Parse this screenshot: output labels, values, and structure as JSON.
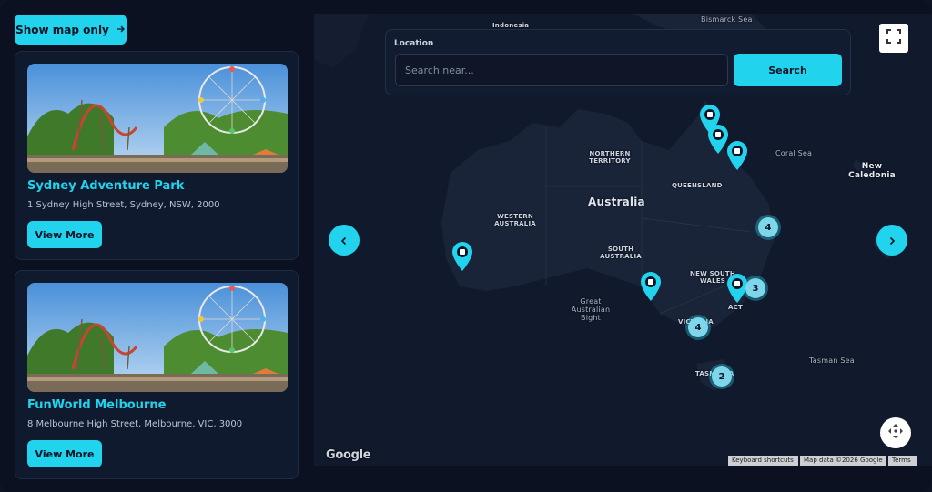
{
  "toolbar": {
    "show_map_label": "Show map only"
  },
  "listings": [
    {
      "title": "Sydney Adventure Park",
      "address": "1 Sydney High Street, Sydney, NSW, 2000",
      "cta": "View More"
    },
    {
      "title": "FunWorld Melbourne",
      "address": "8 Melbourne High Street, Melbourne, VIC, 3000",
      "cta": "View More"
    }
  ],
  "search": {
    "label": "Location",
    "placeholder": "Search near...",
    "button": "Search"
  },
  "map": {
    "labels": {
      "indonesia": "Indonesia",
      "bismarck_sea": "Bismarck Sea",
      "coral_sea": "Coral Sea",
      "new_caledonia": "New Caledonia",
      "northern_territory": "NORTHERN TERRITORY",
      "queensland": "QUEENSLAND",
      "australia": "Australia",
      "western_australia": "WESTERN AUSTRALIA",
      "south_australia": "SOUTH AUSTRALIA",
      "new_south_wales": "NEW SOUTH WALES",
      "act": "ACT",
      "victoria": "VICTORIA",
      "tasmania": "TASMANIA",
      "great_australian_bight": "Great Australian Bight",
      "tasman_sea": "Tasman Sea"
    },
    "clusters": {
      "qld": "4",
      "nsw": "3",
      "vic": "4",
      "tas": "2"
    },
    "google": "Google",
    "attribution": {
      "shortcuts": "Keyboard shortcuts",
      "data": "Map data ©2026 Google",
      "terms": "Terms"
    }
  },
  "colors": {
    "accent": "#22d3ee",
    "background": "#0b1120",
    "card": "#101a2e",
    "land": "#1a2438"
  }
}
